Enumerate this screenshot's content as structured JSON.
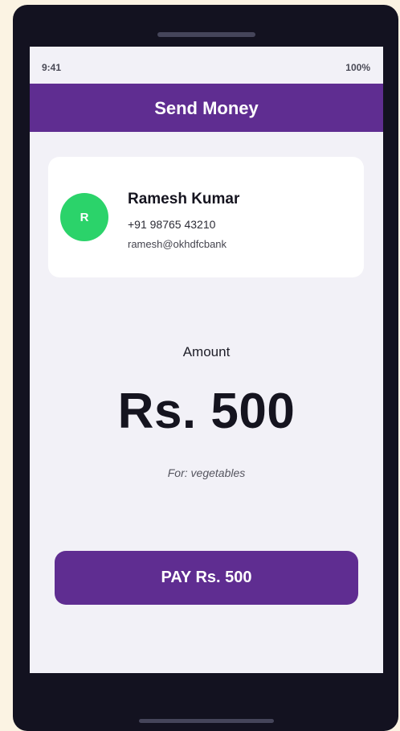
{
  "status_bar": {
    "time": "9:41",
    "battery": "100%"
  },
  "app_bar": {
    "title": "Send Money"
  },
  "payee": {
    "avatar_initial": "R",
    "name": "Ramesh Kumar",
    "phone": "+91 98765 43210",
    "vpa": "ramesh@okhdfcbank"
  },
  "payment": {
    "amount_label": "Amount",
    "amount": "Rs. 500",
    "note": "For: vegetables"
  },
  "actions": {
    "pay_label": "PAY Rs. 500"
  },
  "colors": {
    "brand_purple": "#5f2d91",
    "avatar_green": "#2bd36a",
    "screen_background": "#f2f1f7",
    "device_body": "#131220"
  }
}
